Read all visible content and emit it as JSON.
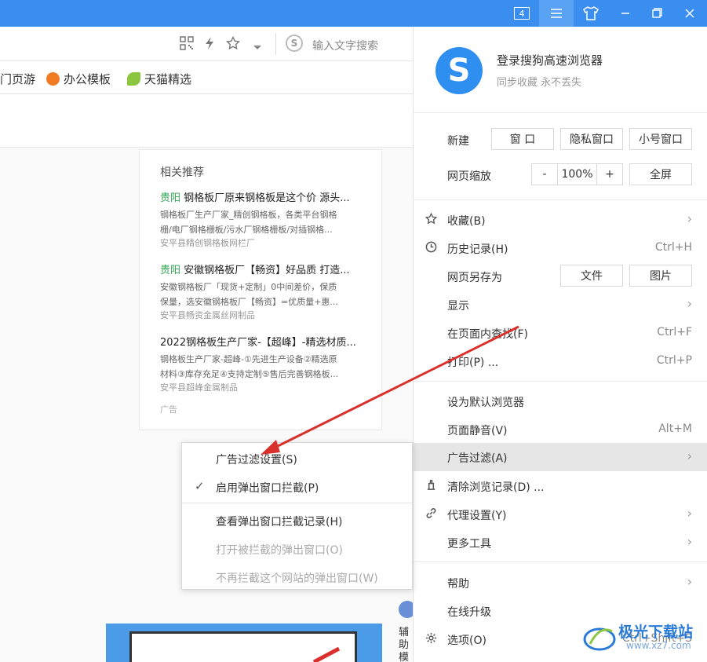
{
  "titlebar": {
    "tab_count": "4",
    "menu_icon": "hamburger-icon",
    "skin_icon": "tshirt-icon",
    "minimize_icon": "minimize-icon",
    "restore_icon": "restore-icon",
    "close_icon": "close-icon"
  },
  "addressbar": {
    "search_placeholder": "输入文字搜索"
  },
  "bookmarks": [
    {
      "label": "门页游"
    },
    {
      "label": "办公模板"
    },
    {
      "label": "天猫精选"
    }
  ],
  "recommend": {
    "title": "相关推荐",
    "items": [
      {
        "city": "贵阳",
        "title": " 钢格板厂原来钢格板是这个价  源头...",
        "desc1": "钢格板厂生产厂家_精创钢格板，各类平台钢格",
        "desc2": "栅/电厂钢格栅板/污水厂钢格栅板/对插钢格...",
        "source": "安平县精创钢格板网栏厂"
      },
      {
        "city": "贵阳",
        "title": " 安徽钢格板厂【畅资】好品质  打造...",
        "desc1": "安徽钢格板厂「现货+定制」0中间差价，保质",
        "desc2": "保量，选安徽钢格板厂【畅资】=优质量+惠...",
        "source": "安平县畅资金属丝网制品"
      },
      {
        "city": "",
        "title": "2022钢格板生产厂家-【超峰】-精选材质...",
        "desc1": "钢格板生产厂家-超峰-①先进生产设备②精选原",
        "desc2": "材料③库存充足④支持定制⑤售后完善钢格板...",
        "source": "安平县超峰金属制品"
      }
    ],
    "ad_label": "广告"
  },
  "sidebar_text": "辅助模式",
  "menu": {
    "login_title": "登录搜狗高速浏览器",
    "login_sub": "同步收藏 永不丢失",
    "new_label": "新建",
    "new_window": "窗 口",
    "private_window": "隐私窗口",
    "small_window": "小号窗口",
    "zoom_label": "网页缩放",
    "zoom_minus": "-",
    "zoom_value": "100%",
    "zoom_plus": "+",
    "fullscreen": "全屏",
    "favorites": "收藏(B)",
    "history": "历史记录(H)",
    "history_sc": "Ctrl+H",
    "save_as": "网页另存为",
    "save_file": "文件",
    "save_image": "图片",
    "display": "显示",
    "find": "在页面内查找(F)",
    "find_sc": "Ctrl+F",
    "print": "打印(P) ...",
    "print_sc": "Ctrl+P",
    "set_default": "设为默认浏览器",
    "mute": "页面静音(V)",
    "mute_sc": "Alt+M",
    "ad_filter": "广告过滤(A)",
    "clear": "清除浏览记录(D) ...",
    "proxy": "代理设置(Y)",
    "more_tools": "更多工具",
    "help": "帮助",
    "upgrade": "在线升级",
    "options": "选项(O)",
    "options_sc": "Ctrl+Shift+S"
  },
  "submenu": {
    "ad_filter_settings": "广告过滤设置(S)",
    "enable_popup_block": "启用弹出窗口拦截(P)",
    "view_popup_log": "查看弹出窗口拦截记录(H)",
    "open_blocked": "打开被拦截的弹出窗口(O)",
    "no_block_site": "不再拦截这个网站的弹出窗口(W)"
  },
  "watermark": {
    "text": "极光下载站",
    "url": "www.xz7.com"
  },
  "colors": {
    "titlebar": "#3a8ef0",
    "accent": "#2f8ff0",
    "city_green": "#2ea44f",
    "annotation_red": "#d9302c"
  }
}
